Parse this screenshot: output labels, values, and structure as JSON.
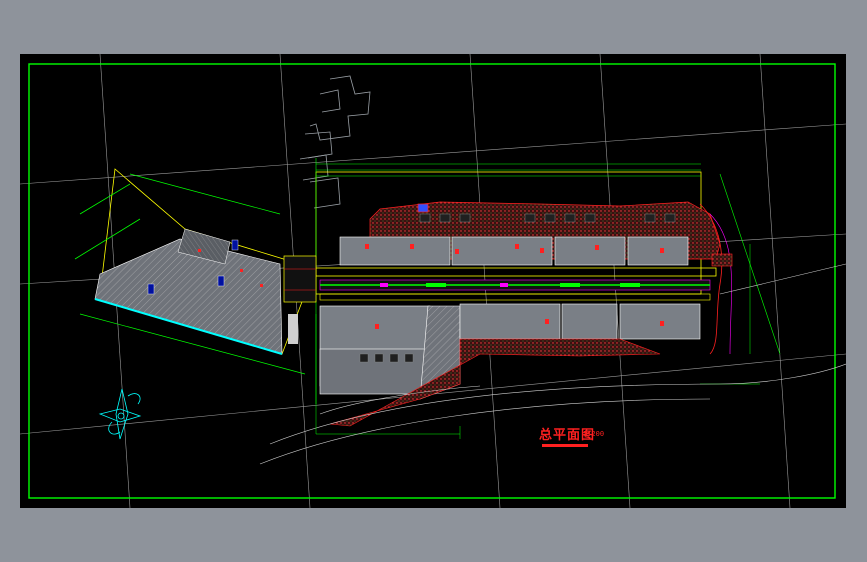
{
  "drawing": {
    "title": "总平面图",
    "scale": "1:200"
  },
  "colors": {
    "canvas": "#000000",
    "frame": "#00ff00",
    "grid": "#d8d8d8",
    "building_fill": "#7a7f86",
    "hatch": "#c8c8c8",
    "outline_yellow": "#ffff00",
    "road_green": "#00ff00",
    "accent_red": "#ff2020",
    "cyan": "#00ffff",
    "magenta": "#ff00ff",
    "blue": "#3050ff"
  }
}
